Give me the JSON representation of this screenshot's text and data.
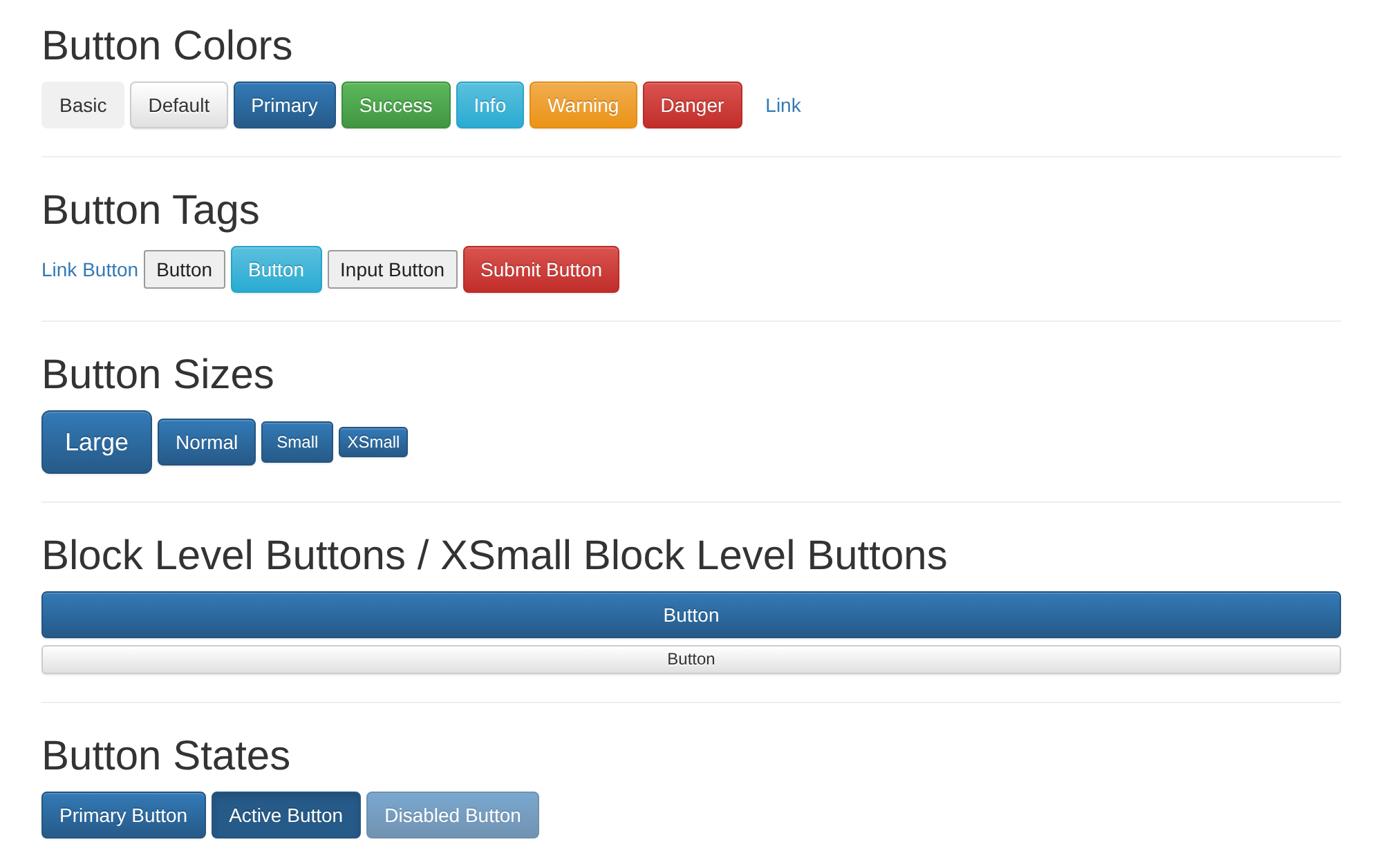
{
  "sections": [
    {
      "heading": "Button Colors",
      "kind": "inline",
      "buttons": [
        {
          "label": "Basic",
          "kind": "basic"
        },
        {
          "label": "Default",
          "kind": "default"
        },
        {
          "label": "Primary",
          "kind": "primary"
        },
        {
          "label": "Success",
          "kind": "success"
        },
        {
          "label": "Info",
          "kind": "info"
        },
        {
          "label": "Warning",
          "kind": "warning"
        },
        {
          "label": "Danger",
          "kind": "danger"
        },
        {
          "label": "Link",
          "kind": "link"
        }
      ]
    },
    {
      "heading": "Button Tags",
      "kind": "inline",
      "buttons": [
        {
          "label": "Link Button",
          "kind": "anchor"
        },
        {
          "label": "Button",
          "kind": "native"
        },
        {
          "label": "Button",
          "kind": "info"
        },
        {
          "label": "Input Button",
          "kind": "native"
        },
        {
          "label": "Submit Button",
          "kind": "danger"
        }
      ]
    },
    {
      "heading": "Button Sizes",
      "kind": "inline",
      "buttons": [
        {
          "label": "Large",
          "kind": "primary-large"
        },
        {
          "label": "Normal",
          "kind": "primary"
        },
        {
          "label": "Small",
          "kind": "primary-small"
        },
        {
          "label": "XSmall",
          "kind": "primary-xsmall"
        }
      ]
    },
    {
      "heading": "Block Level Buttons / XSmall Block Level Buttons",
      "kind": "block",
      "buttons": [
        {
          "label": "Button",
          "kind": "primary"
        },
        {
          "label": "Button",
          "kind": "default-xsmall"
        }
      ]
    },
    {
      "heading": "Button States",
      "kind": "inline",
      "buttons": [
        {
          "label": "Primary Button",
          "kind": "primary",
          "active": false,
          "disabled": false
        },
        {
          "label": "Active Button",
          "kind": "primary",
          "active": true,
          "disabled": false
        },
        {
          "label": "Disabled Button",
          "kind": "primary",
          "active": false,
          "disabled": true
        }
      ]
    }
  ]
}
